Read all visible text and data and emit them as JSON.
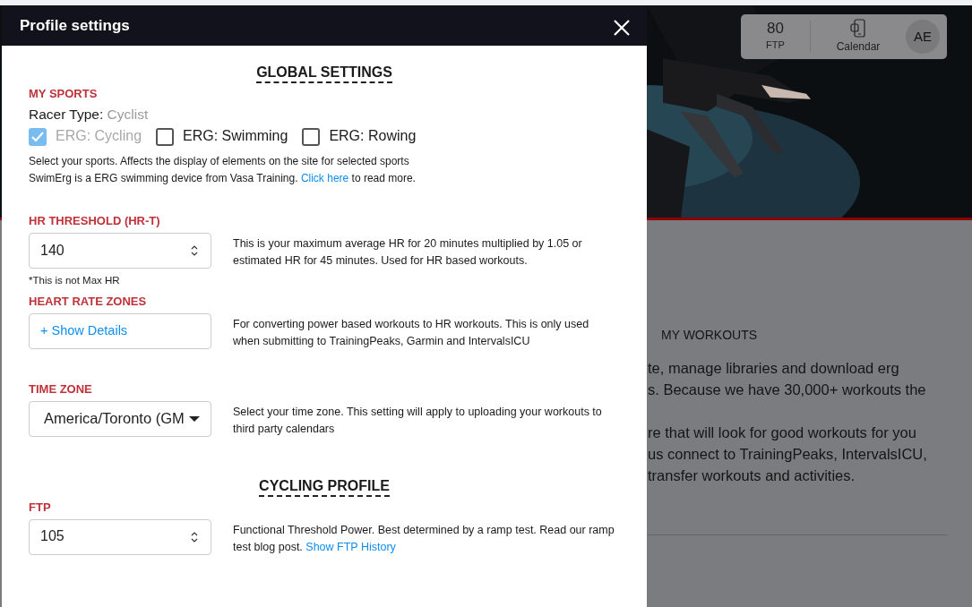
{
  "background": {
    "ftp": {
      "value": "80",
      "label": "FTP"
    },
    "calendar": "Calendar",
    "avatar": "AE",
    "section_title": "MY WORKOUTS",
    "paragraphs": [
      [
        "te, manage libraries and download erg",
        "s. Because we have 30,000+ workouts the"
      ],
      [
        "re that will look for good workouts for you",
        "us connect to TrainingPeaks, IntervalsICU,",
        "transfer workouts and activities."
      ]
    ]
  },
  "modal": {
    "title": "Profile settings",
    "sections": [
      {
        "heading": "GLOBAL SETTINGS",
        "fields": [
          {
            "kind": "sports",
            "label": "MY SPORTS",
            "racer_type_label": "Racer Type:",
            "racer_type": "Cyclist",
            "checkboxes": [
              {
                "label": "ERG: Cycling",
                "checked": true,
                "disabled": true
              },
              {
                "label": "ERG: Swimming",
                "checked": false,
                "disabled": false
              },
              {
                "label": "ERG: Rowing",
                "checked": false,
                "disabled": false
              }
            ],
            "help": [
              [
                {
                  "text": "Select your sports. Affects the display of elements on the site for selected sports"
                }
              ],
              [
                {
                  "text": "SwimErg is a ERG swimming device from Vasa Training. "
                },
                {
                  "text": "Click here",
                  "kind": "link"
                },
                {
                  "text": " to read more."
                }
              ]
            ]
          },
          {
            "kind": "number",
            "label": "HR THRESHOLD (HR-T)",
            "value": "140",
            "note": "*This is not Max HR",
            "help": [
              [
                {
                  "text": "This is your maximum average HR for 20 minutes multiplied by 1.05 or estimated HR for 45 minutes. Used for HR based workouts."
                }
              ]
            ]
          },
          {
            "kind": "details",
            "label": "HEART RATE ZONES",
            "button": "+ Show Details",
            "help": [
              [
                {
                  "text": "For converting power based workouts to HR workouts. This is only used when submitting to TrainingPeaks, Garmin and IntervalsICU"
                }
              ]
            ]
          },
          {
            "kind": "select",
            "label": "TIME ZONE",
            "value": "America/Toronto (GM",
            "help": [
              [
                {
                  "text": "Select your time zone. This setting will apply to uploading your workouts to third party calendars"
                }
              ]
            ]
          }
        ]
      },
      {
        "heading": "CYCLING PROFILE",
        "fields": [
          {
            "kind": "number",
            "label": "FTP",
            "value": "105",
            "help": [
              [
                {
                  "text": "Functional Threshold Power. Best determined by a ramp test. Read our ramp test blog post. "
                },
                {
                  "text": "Show FTP History",
                  "kind": "link"
                }
              ]
            ]
          }
        ]
      }
    ]
  }
}
